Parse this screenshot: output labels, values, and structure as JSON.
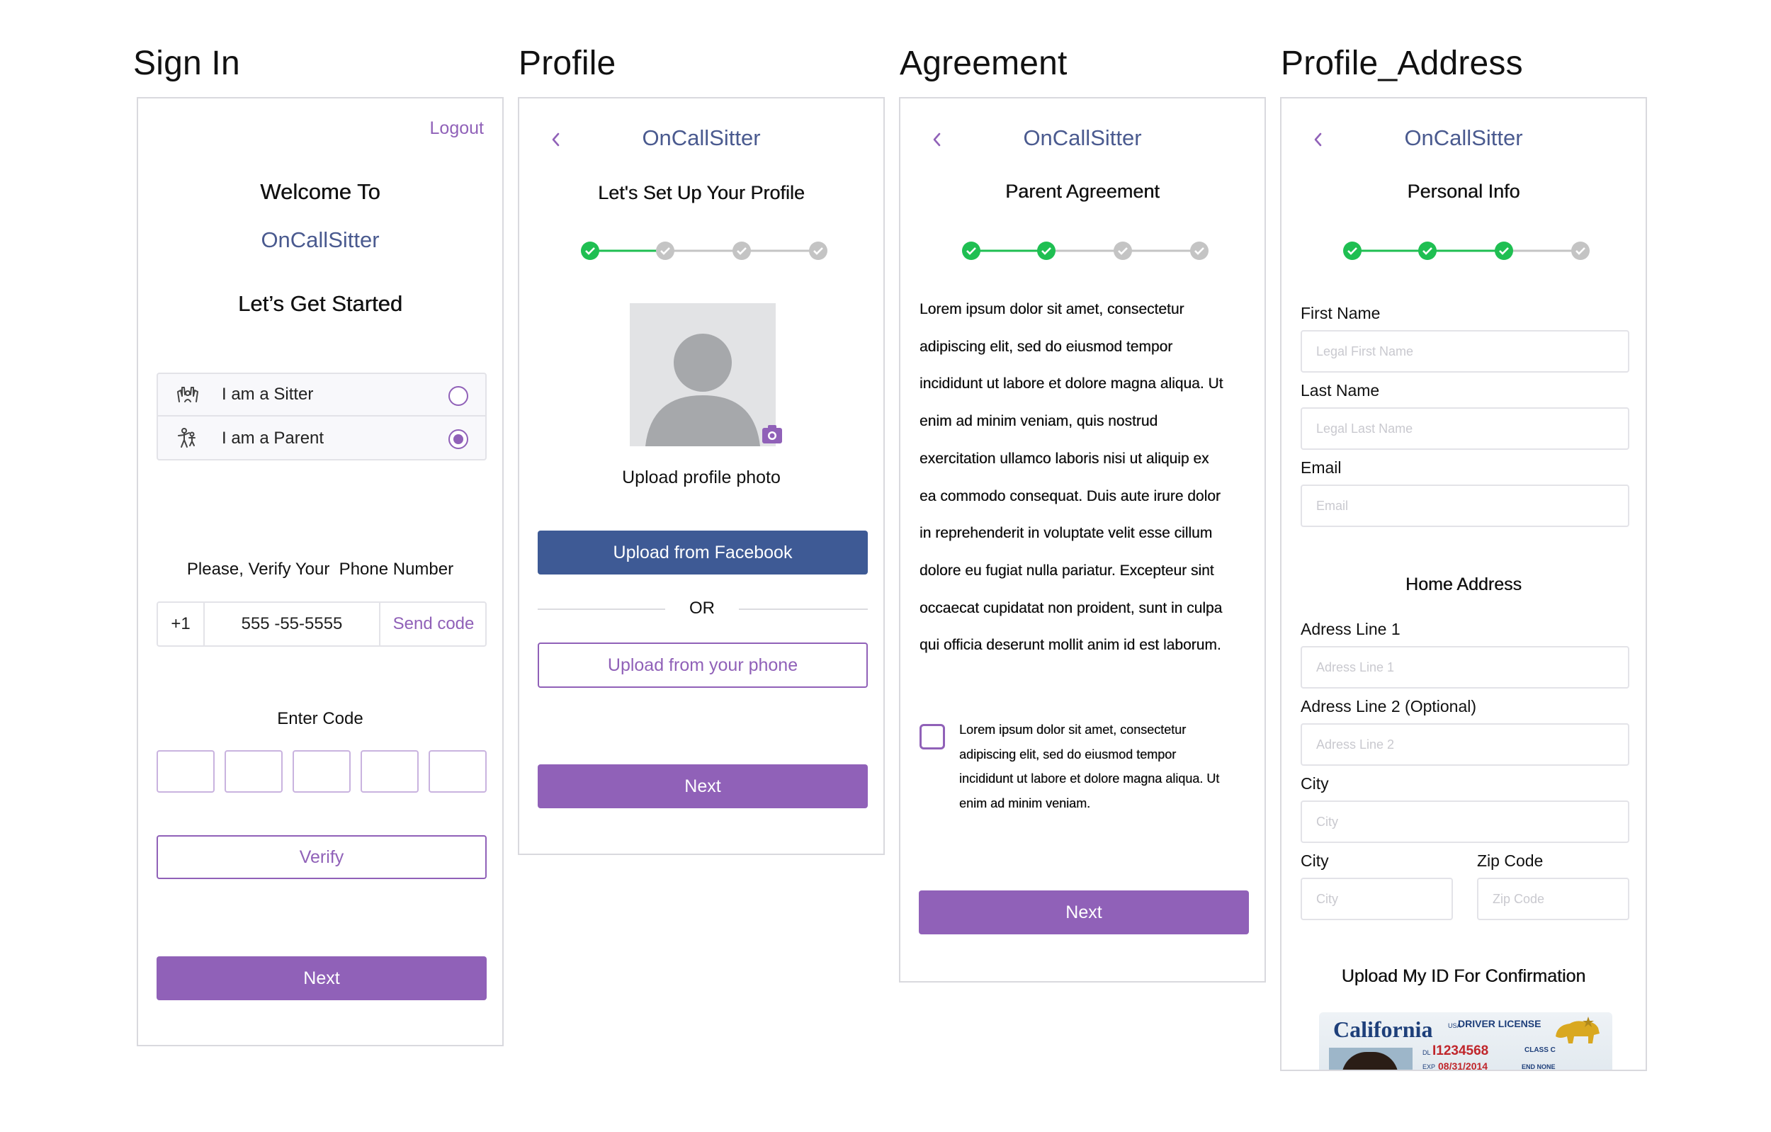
{
  "titles": [
    "Sign In",
    "Profile",
    "Agreement",
    "Profile_Address"
  ],
  "brand": "OnCallSitter",
  "colors": {
    "accent": "#9061b8",
    "brand": "#4a5a8f",
    "facebook": "#3e5a95",
    "step_done": "#1fbf52",
    "step_todo": "#c4c4c4"
  },
  "signin": {
    "logout": "Logout",
    "welcome": "Welcome To",
    "brand": "OnCallSitter",
    "started": "Let’s Get Started",
    "roles": [
      {
        "label": "I am a Sitter",
        "icon": "sitter-icon",
        "selected": false
      },
      {
        "label": "I am a Parent",
        "icon": "parent-icon",
        "selected": true
      }
    ],
    "verify_prompt": "Please, Verify Your  Phone Number",
    "country_code": "+1",
    "phone": "555 -55-5555",
    "send_code": "Send code",
    "enter_code": "Enter Code",
    "verify": "Verify",
    "next": "Next"
  },
  "profile": {
    "heading": "Let's Set Up Your Profile",
    "steps_done": 1,
    "upload_photo": "Upload profile photo",
    "upload_facebook": "Upload from Facebook",
    "or": "OR",
    "upload_phone": "Upload from your phone",
    "next": "Next"
  },
  "agreement": {
    "heading": "Parent Agreement",
    "steps_done": 2,
    "body_lines": [
      "Lorem ipsum dolor sit amet, consectetur",
      "adipiscing elit, sed do eiusmod tempor",
      "incididunt ut labore et dolore magna aliqua. Ut",
      "enim ad minim veniam, quis nostrud",
      "exercitation ullamco laboris nisi ut aliquip ex",
      "ea commodo consequat. Duis aute irure dolor",
      "in reprehenderit in voluptate velit esse cillum",
      "dolore eu fugiat nulla pariatur. Excepteur sint",
      "occaecat cupidatat non proident, sunt in culpa",
      "qui officia deserunt mollit anim id est laborum."
    ],
    "checkbox_lines": [
      "Lorem ipsum dolor sit amet, consectetur",
      "adipiscing elit, sed do eiusmod tempor",
      "incididunt ut labore et dolore magna aliqua. Ut",
      "enim ad minim veniam."
    ],
    "checked": false,
    "next": "Next"
  },
  "address": {
    "heading": "Personal Info",
    "steps_done": 3,
    "first_name": {
      "label": "First Name",
      "placeholder": "Legal First Name"
    },
    "last_name": {
      "label": "Last Name",
      "placeholder": "Legal Last Name"
    },
    "email": {
      "label": "Email",
      "placeholder": "Email"
    },
    "home_address": "Home Address",
    "line1": {
      "label": "Adress Line 1",
      "placeholder": "Adress Line 1"
    },
    "line2": {
      "label": "Adress Line 2 (Optional)",
      "placeholder": "Adress Line 2"
    },
    "city": {
      "label": "City",
      "placeholder": "City"
    },
    "city2": {
      "label": "City",
      "placeholder": "City"
    },
    "zip": {
      "label": "Zip Code",
      "placeholder": "Zip Code"
    },
    "upload_id": "Upload My ID For Confirmation",
    "license": {
      "state": "California",
      "usa": "USA",
      "type": "DRIVER LICENSE",
      "dl_prefix": "DL",
      "dl_number": "I1234568",
      "class": "CLASS C",
      "exp_prefix": "EXP",
      "exp": "08/31/2014",
      "end": "END NONE"
    }
  }
}
